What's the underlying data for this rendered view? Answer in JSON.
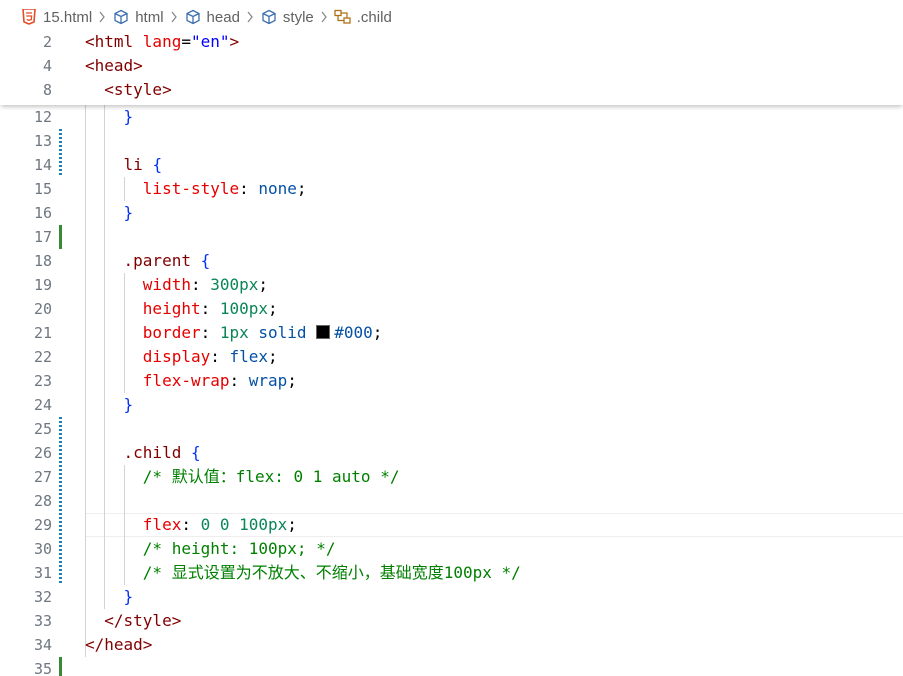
{
  "breadcrumb": {
    "items": [
      {
        "label": "15.html",
        "icon": "html5-icon"
      },
      {
        "label": "html",
        "icon": "cube-icon"
      },
      {
        "label": "head",
        "icon": "cube-icon"
      },
      {
        "label": "style",
        "icon": "cube-icon"
      },
      {
        "label": ".child",
        "icon": "css-selector-icon"
      }
    ]
  },
  "sticky_lines": [
    {
      "num": "2",
      "parts": [
        [
          "tag",
          "<html "
        ],
        [
          "attr",
          "lang"
        ],
        [
          "punct",
          "="
        ],
        [
          "str",
          "\"en\""
        ],
        [
          "tag",
          ">"
        ]
      ]
    },
    {
      "num": "4",
      "parts": [
        [
          "tag",
          "<head>"
        ]
      ]
    },
    {
      "num": "8",
      "parts": [
        [
          "tag",
          "  <style>"
        ]
      ]
    }
  ],
  "lines": [
    {
      "num": "12",
      "parts": [
        [
          "brace1",
          "    }"
        ]
      ]
    },
    {
      "num": "13",
      "parts": []
    },
    {
      "num": "14",
      "parts": [
        [
          "sel",
          "    li "
        ],
        [
          "brace1",
          "{"
        ]
      ]
    },
    {
      "num": "15",
      "parts": [
        [
          "prop",
          "      list-style"
        ],
        [
          "punct",
          ": "
        ],
        [
          "val",
          "none"
        ],
        [
          "punct",
          ";"
        ]
      ]
    },
    {
      "num": "16",
      "parts": [
        [
          "brace1",
          "    }"
        ]
      ]
    },
    {
      "num": "17",
      "parts": []
    },
    {
      "num": "18",
      "parts": [
        [
          "sel",
          "    .parent "
        ],
        [
          "brace1",
          "{"
        ]
      ]
    },
    {
      "num": "19",
      "parts": [
        [
          "prop",
          "      width"
        ],
        [
          "punct",
          ": "
        ],
        [
          "num",
          "300px"
        ],
        [
          "punct",
          ";"
        ]
      ]
    },
    {
      "num": "20",
      "parts": [
        [
          "prop",
          "      height"
        ],
        [
          "punct",
          ": "
        ],
        [
          "num",
          "100px"
        ],
        [
          "punct",
          ";"
        ]
      ]
    },
    {
      "num": "21",
      "parts": [
        [
          "prop",
          "      border"
        ],
        [
          "punct",
          ": "
        ],
        [
          "num",
          "1px"
        ],
        [
          "val",
          " solid "
        ],
        [
          "swatch",
          ""
        ],
        [
          "val",
          "#000"
        ],
        [
          "punct",
          ";"
        ]
      ]
    },
    {
      "num": "22",
      "parts": [
        [
          "prop",
          "      display"
        ],
        [
          "punct",
          ": "
        ],
        [
          "val",
          "flex"
        ],
        [
          "punct",
          ";"
        ]
      ]
    },
    {
      "num": "23",
      "parts": [
        [
          "prop",
          "      flex-wrap"
        ],
        [
          "punct",
          ": "
        ],
        [
          "val",
          "wrap"
        ],
        [
          "punct",
          ";"
        ]
      ]
    },
    {
      "num": "24",
      "parts": [
        [
          "brace1",
          "    }"
        ]
      ]
    },
    {
      "num": "25",
      "parts": []
    },
    {
      "num": "26",
      "parts": [
        [
          "sel",
          "    .child "
        ],
        [
          "brace1",
          "{"
        ]
      ]
    },
    {
      "num": "27",
      "parts": [
        [
          "comment",
          "      /* 默认值：flex: 0 1 auto */"
        ]
      ]
    },
    {
      "num": "28",
      "parts": []
    },
    {
      "num": "29",
      "parts": [
        [
          "prop",
          "      flex"
        ],
        [
          "punct",
          ": "
        ],
        [
          "num",
          "0 0 100px"
        ],
        [
          "punct",
          ";"
        ]
      ]
    },
    {
      "num": "30",
      "parts": [
        [
          "comment",
          "      /* height: 100px; */"
        ]
      ]
    },
    {
      "num": "31",
      "parts": [
        [
          "comment",
          "      /* 显式设置为不放大、不缩小，基础宽度100px */"
        ]
      ]
    },
    {
      "num": "32",
      "parts": [
        [
          "brace1",
          "    }"
        ]
      ]
    },
    {
      "num": "33",
      "parts": [
        [
          "tag",
          "  </style>"
        ]
      ]
    },
    {
      "num": "34",
      "parts": [
        [
          "tag",
          "</head>"
        ]
      ]
    },
    {
      "num": "35",
      "parts": []
    }
  ],
  "gutter": {
    "striped": [
      "13",
      "14",
      "25",
      "26",
      "27",
      "28",
      "29",
      "30",
      "31"
    ],
    "green": [
      "17",
      "35"
    ]
  },
  "current_line": "29",
  "colors": {
    "tag": "#800000",
    "attribute": "#e50000",
    "string": "#0000ff",
    "property": "#e50000",
    "number": "#098658",
    "value": "#0451a5",
    "comment": "#008000",
    "brace": "#0431fa"
  }
}
